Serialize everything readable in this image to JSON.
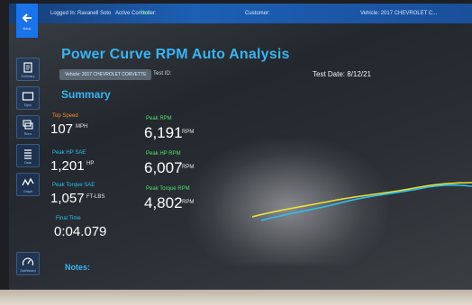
{
  "header": {
    "logged_in": "Logged In: Ravanell Soto",
    "active_controller_label": "Active Controller:",
    "active_controller_value": "Yes",
    "customer_label": "Customer:",
    "vehicle": "Vehicle: 2017 CHEVROLET C..."
  },
  "nav": {
    "back_label": "Back",
    "items": [
      {
        "label": "Summary",
        "icon": "document-icon"
      },
      {
        "label": "Dyno",
        "icon": "screen-icon"
      },
      {
        "label": "Runs",
        "icon": "stack-icon"
      },
      {
        "label": "Data",
        "icon": "list-icon"
      },
      {
        "label": "Graph",
        "icon": "wave-icon"
      }
    ],
    "gauge_label": "Dashboard"
  },
  "page": {
    "title": "Power Curve RPM Auto Analysis",
    "vehicle_pill": "Vehicle: 2017 CHEVROLET CORVETTE",
    "test_id": "Test ID:",
    "test_date": "Test Date: 8/12/21",
    "summary_heading": "Summary",
    "notes_label": "Notes:"
  },
  "metrics_left": [
    {
      "label": "Top Speed",
      "value": "107",
      "unit": "MPH"
    },
    {
      "label": "Peak HP SAE",
      "value": "1,201",
      "unit": "HP"
    },
    {
      "label": "Peak Torque SAE",
      "value": "1,057",
      "unit": "FT-LBS"
    },
    {
      "label": "Final Time",
      "value": "0:04.079",
      "unit": ""
    }
  ],
  "metrics_right": [
    {
      "label": "Peak RPM",
      "value": "6,191",
      "unit": "RPM"
    },
    {
      "label": "Peak HP RPM",
      "value": "6,007",
      "unit": "RPM"
    },
    {
      "label": "Peak Torque RPM",
      "value": "4,802",
      "unit": "RPM"
    }
  ],
  "colors": {
    "accent": "#39b4f2",
    "label_orange": "#ff8a2a",
    "label_green": "#4fe06a",
    "curve_yellow": "#e8e23a",
    "curve_cyan": "#2bc0f0"
  }
}
